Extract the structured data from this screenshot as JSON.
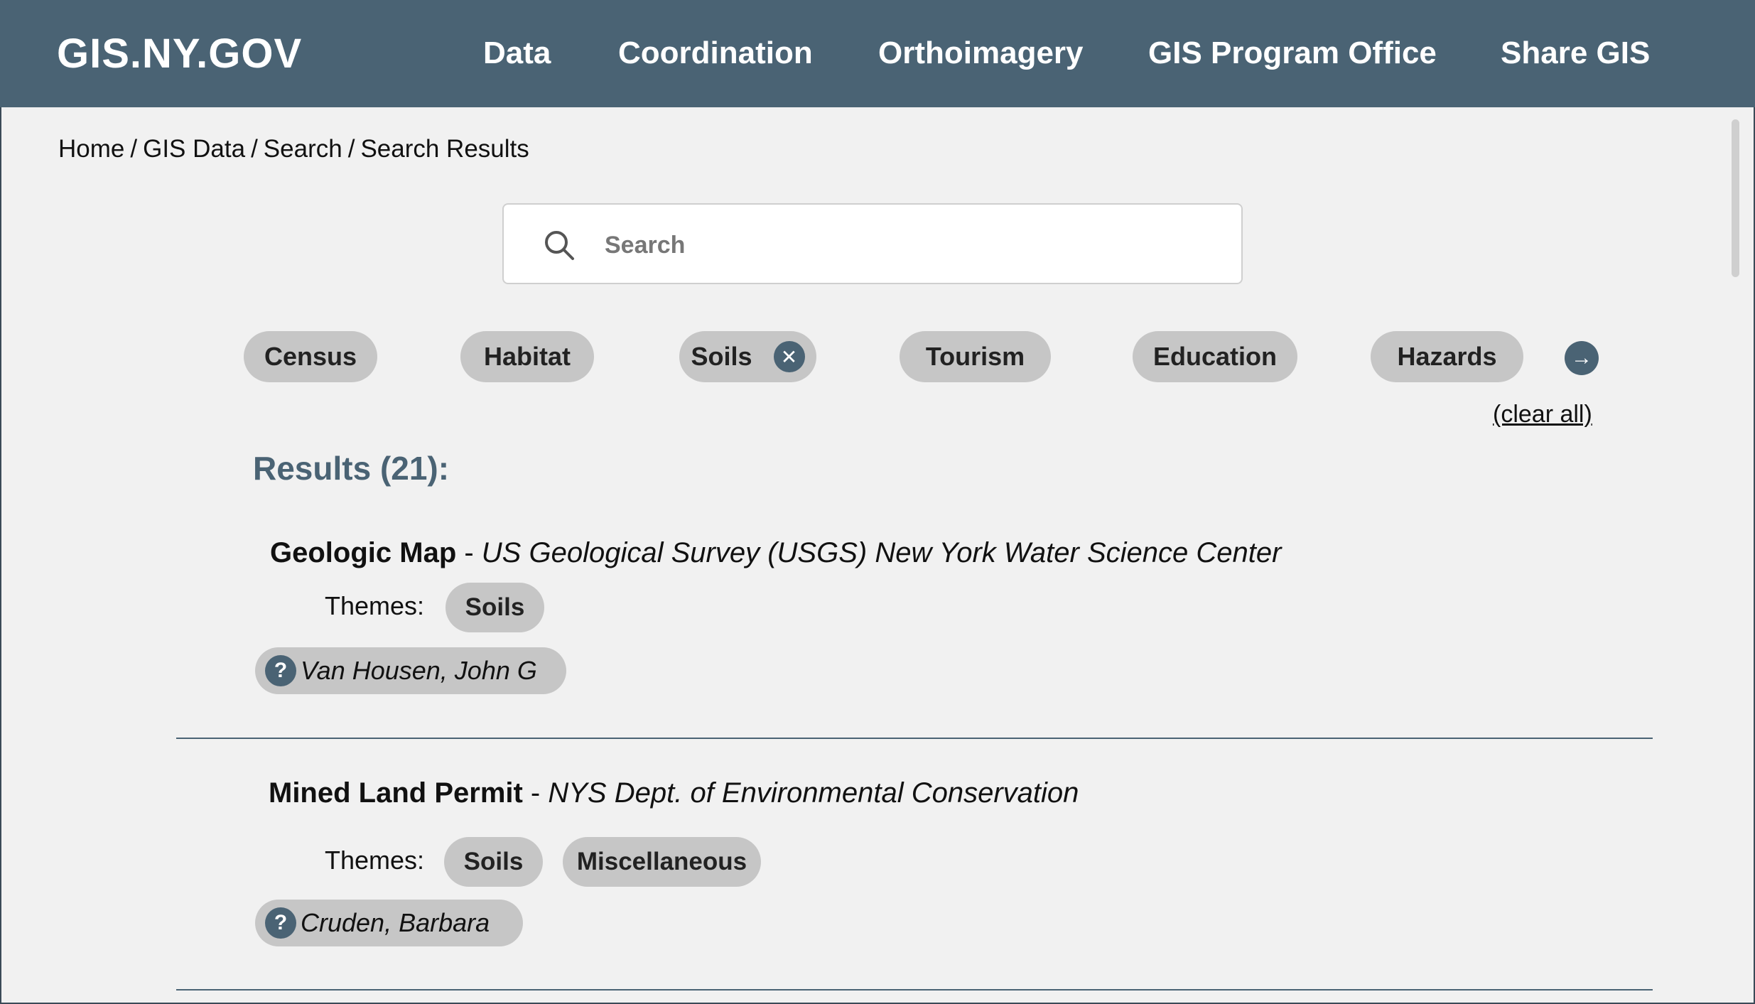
{
  "header": {
    "brand": "GIS.NY.GOV",
    "nav": [
      "Data",
      "Coordination",
      "Orthoimagery",
      "GIS Program Office",
      "Share GIS"
    ],
    "background_color": "#4a6374"
  },
  "breadcrumb": [
    "Home",
    "GIS Data",
    "Search",
    "Search Results"
  ],
  "search": {
    "placeholder": "Search",
    "value": "",
    "icon": "search-icon"
  },
  "filters": {
    "chips": [
      {
        "label": "Census",
        "selected": false
      },
      {
        "label": "Habitat",
        "selected": false
      },
      {
        "label": "Soils",
        "selected": true,
        "remove_icon": "close-icon"
      },
      {
        "label": "Tourism",
        "selected": false
      },
      {
        "label": "Education",
        "selected": false
      },
      {
        "label": "Hazards",
        "selected": false
      }
    ],
    "next_icon": "arrow-right-icon",
    "clear_all": "(clear all)"
  },
  "results": {
    "heading": "Results (21):",
    "items": [
      {
        "name": "Geologic Map",
        "org_sep": " - ",
        "organization": "US Geological Survey (USGS) New York Water Science Center",
        "themes_label": "Themes:",
        "themes": [
          "Soils"
        ],
        "author_icon": "question-icon",
        "author": "Van Housen, John G"
      },
      {
        "name": "Mined Land Permit",
        "org_sep": " - ",
        "organization": "NYS Dept. of Environmental Conservation",
        "themes_label": "Themes:",
        "themes": [
          "Soils",
          "Miscellaneous"
        ],
        "author_icon": "question-icon",
        "author": "Cruden, Barbara"
      }
    ]
  },
  "colors": {
    "accent": "#4a6374",
    "chip": "#c6c6c6",
    "background": "#f1f1f1"
  }
}
